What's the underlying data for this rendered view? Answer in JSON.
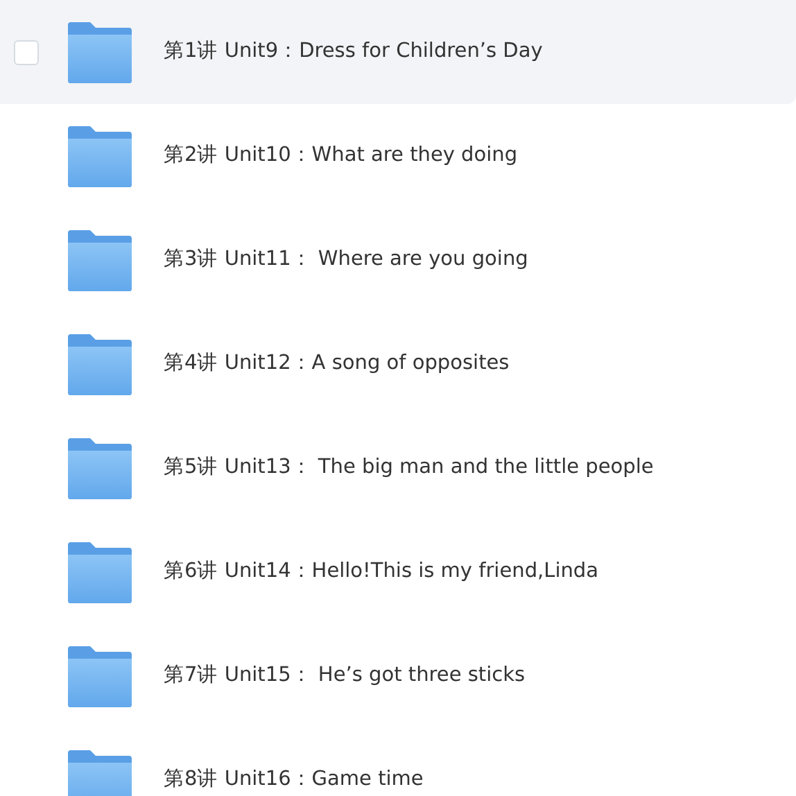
{
  "folders": [
    {
      "name": "第1讲 Unit9：Dress for Children’s Day",
      "hovered": true,
      "checked": false
    },
    {
      "name": "第2讲 Unit10：What are they doing",
      "hovered": false,
      "checked": false
    },
    {
      "name": "第3讲 Unit11： Where are you going",
      "hovered": false,
      "checked": false
    },
    {
      "name": "第4讲 Unit12：A song of opposites",
      "hovered": false,
      "checked": false
    },
    {
      "name": "第5讲 Unit13： The big man and the little people",
      "hovered": false,
      "checked": false
    },
    {
      "name": "第6讲 Unit14：Hello!This is my friend,Linda",
      "hovered": false,
      "checked": false
    },
    {
      "name": "第7讲 Unit15： He’s got three sticks",
      "hovered": false,
      "checked": false
    },
    {
      "name": "第8讲 Unit16：Game time",
      "hovered": false,
      "checked": false
    }
  ]
}
